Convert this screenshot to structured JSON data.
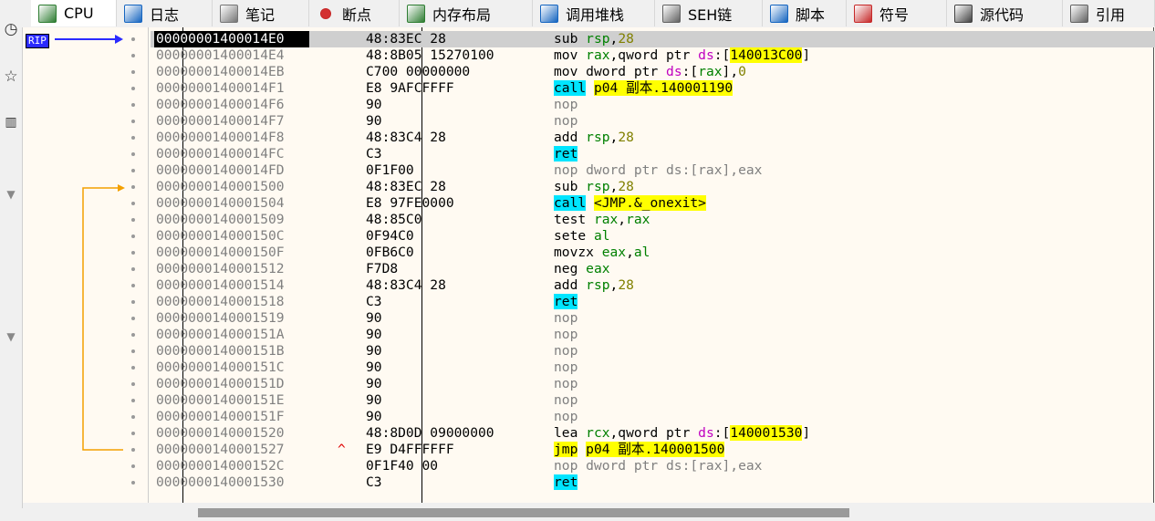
{
  "tabs": [
    {
      "label": "CPU",
      "icon": "cpu-icon",
      "active": true
    },
    {
      "label": "日志",
      "icon": "log-icon"
    },
    {
      "label": "笔记",
      "icon": "notes-icon"
    },
    {
      "label": "断点",
      "icon": "breakpoint-icon"
    },
    {
      "label": "内存布局",
      "icon": "memory-map-icon"
    },
    {
      "label": "调用堆栈",
      "icon": "call-stack-icon"
    },
    {
      "label": "SEH链",
      "icon": "seh-chain-icon"
    },
    {
      "label": "脚本",
      "icon": "script-icon"
    },
    {
      "label": "符号",
      "icon": "symbols-icon"
    },
    {
      "label": "源代码",
      "icon": "source-icon"
    },
    {
      "label": "引用",
      "icon": "references-icon"
    }
  ],
  "rip_label": "RIP",
  "rows": [
    {
      "addr": "00000001400014E0",
      "bytes": "48:83EC 28",
      "parts": [
        [
          "mn",
          "sub "
        ],
        [
          "reg",
          "rsp"
        ],
        [
          "mn",
          ","
        ],
        [
          "num",
          "28"
        ]
      ]
    },
    {
      "addr": "00000001400014E4",
      "bytes": "48:8B05 15270100",
      "parts": [
        [
          "mn",
          "mov "
        ],
        [
          "reg",
          "rax"
        ],
        [
          "mn",
          ",qword ptr "
        ],
        [
          "seg",
          "ds"
        ],
        [
          "mn",
          ":["
        ],
        [
          "hl-y",
          "140013C00"
        ],
        [
          "mn",
          "]"
        ]
      ]
    },
    {
      "addr": "00000001400014EB",
      "bytes": "C700 00000000",
      "parts": [
        [
          "mn",
          "mov "
        ],
        [
          "kw",
          "dword ptr "
        ],
        [
          "seg",
          "ds"
        ],
        [
          "mn",
          ":["
        ],
        [
          "reg",
          "rax"
        ],
        [
          "mn",
          "],"
        ],
        [
          "num",
          "0"
        ]
      ]
    },
    {
      "addr": "00000001400014F1",
      "bytes": "E8 9AFCFFFF",
      "parts": [
        [
          "hl-c",
          "call"
        ],
        [
          "mn",
          " "
        ],
        [
          "hl-y",
          "p04 副本.140001190"
        ]
      ]
    },
    {
      "addr": "00000001400014F6",
      "bytes": "90",
      "parts": [
        [
          "mnop",
          "nop"
        ]
      ]
    },
    {
      "addr": "00000001400014F7",
      "bytes": "90",
      "parts": [
        [
          "mnop",
          "nop"
        ]
      ]
    },
    {
      "addr": "00000001400014F8",
      "bytes": "48:83C4 28",
      "parts": [
        [
          "mn",
          "add "
        ],
        [
          "reg",
          "rsp"
        ],
        [
          "mn",
          ","
        ],
        [
          "num",
          "28"
        ]
      ]
    },
    {
      "addr": "00000001400014FC",
      "bytes": "C3",
      "parts": [
        [
          "hl-c",
          "ret"
        ]
      ]
    },
    {
      "addr": "00000001400014FD",
      "bytes": "0F1F00",
      "parts": [
        [
          "mnop",
          "nop dword ptr ds:[rax],eax"
        ]
      ]
    },
    {
      "addr": "0000000140001500",
      "bytes": "48:83EC 28",
      "parts": [
        [
          "mn",
          "sub "
        ],
        [
          "reg",
          "rsp"
        ],
        [
          "mn",
          ","
        ],
        [
          "num",
          "28"
        ]
      ]
    },
    {
      "addr": "0000000140001504",
      "bytes": "E8 97FE0000",
      "parts": [
        [
          "hl-c",
          "call"
        ],
        [
          "mn",
          " "
        ],
        [
          "hl-y",
          "<JMP.&_onexit>"
        ]
      ]
    },
    {
      "addr": "0000000140001509",
      "bytes": "48:85C0",
      "parts": [
        [
          "mn",
          "test "
        ],
        [
          "reg",
          "rax"
        ],
        [
          "mn",
          ","
        ],
        [
          "reg",
          "rax"
        ]
      ]
    },
    {
      "addr": "000000014000150C",
      "bytes": "0F94C0",
      "parts": [
        [
          "mn",
          "sete "
        ],
        [
          "reg",
          "al"
        ]
      ]
    },
    {
      "addr": "000000014000150F",
      "bytes": "0FB6C0",
      "parts": [
        [
          "mn",
          "movzx "
        ],
        [
          "reg",
          "eax"
        ],
        [
          "mn",
          ","
        ],
        [
          "reg",
          "al"
        ]
      ]
    },
    {
      "addr": "0000000140001512",
      "bytes": "F7D8",
      "parts": [
        [
          "mn",
          "neg "
        ],
        [
          "reg",
          "eax"
        ]
      ]
    },
    {
      "addr": "0000000140001514",
      "bytes": "48:83C4 28",
      "parts": [
        [
          "mn",
          "add "
        ],
        [
          "reg",
          "rsp"
        ],
        [
          "mn",
          ","
        ],
        [
          "num",
          "28"
        ]
      ]
    },
    {
      "addr": "0000000140001518",
      "bytes": "C3",
      "parts": [
        [
          "hl-c",
          "ret"
        ]
      ]
    },
    {
      "addr": "0000000140001519",
      "bytes": "90",
      "parts": [
        [
          "mnop",
          "nop"
        ]
      ]
    },
    {
      "addr": "000000014000151A",
      "bytes": "90",
      "parts": [
        [
          "mnop",
          "nop"
        ]
      ]
    },
    {
      "addr": "000000014000151B",
      "bytes": "90",
      "parts": [
        [
          "mnop",
          "nop"
        ]
      ]
    },
    {
      "addr": "000000014000151C",
      "bytes": "90",
      "parts": [
        [
          "mnop",
          "nop"
        ]
      ]
    },
    {
      "addr": "000000014000151D",
      "bytes": "90",
      "parts": [
        [
          "mnop",
          "nop"
        ]
      ]
    },
    {
      "addr": "000000014000151E",
      "bytes": "90",
      "parts": [
        [
          "mnop",
          "nop"
        ]
      ]
    },
    {
      "addr": "000000014000151F",
      "bytes": "90",
      "parts": [
        [
          "mnop",
          "nop"
        ]
      ]
    },
    {
      "addr": "0000000140001520",
      "bytes": "48:8D0D 09000000",
      "parts": [
        [
          "mn",
          "lea "
        ],
        [
          "reg",
          "rcx"
        ],
        [
          "mn",
          ",qword ptr "
        ],
        [
          "seg",
          "ds"
        ],
        [
          "mn",
          ":["
        ],
        [
          "hl-y",
          "140001530"
        ],
        [
          "mn",
          "]"
        ]
      ]
    },
    {
      "addr": "0000000140001527",
      "bytes": "E9 D4FFFFFF",
      "mark": "^",
      "parts": [
        [
          "hl-y",
          "jmp"
        ],
        [
          "mn",
          " "
        ],
        [
          "hl-y",
          "p04 副本.140001500"
        ]
      ]
    },
    {
      "addr": "000000014000152C",
      "bytes": "0F1F40 00",
      "parts": [
        [
          "mnop",
          "nop dword ptr ds:[rax],eax"
        ]
      ]
    },
    {
      "addr": "0000000140001530",
      "bytes": "C3",
      "parts": [
        [
          "hl-c",
          "ret"
        ]
      ]
    }
  ],
  "colors": {
    "rip_arrow": "#2a2aff",
    "jump_arrow": "#f4a000",
    "background": "#fffaf2"
  }
}
